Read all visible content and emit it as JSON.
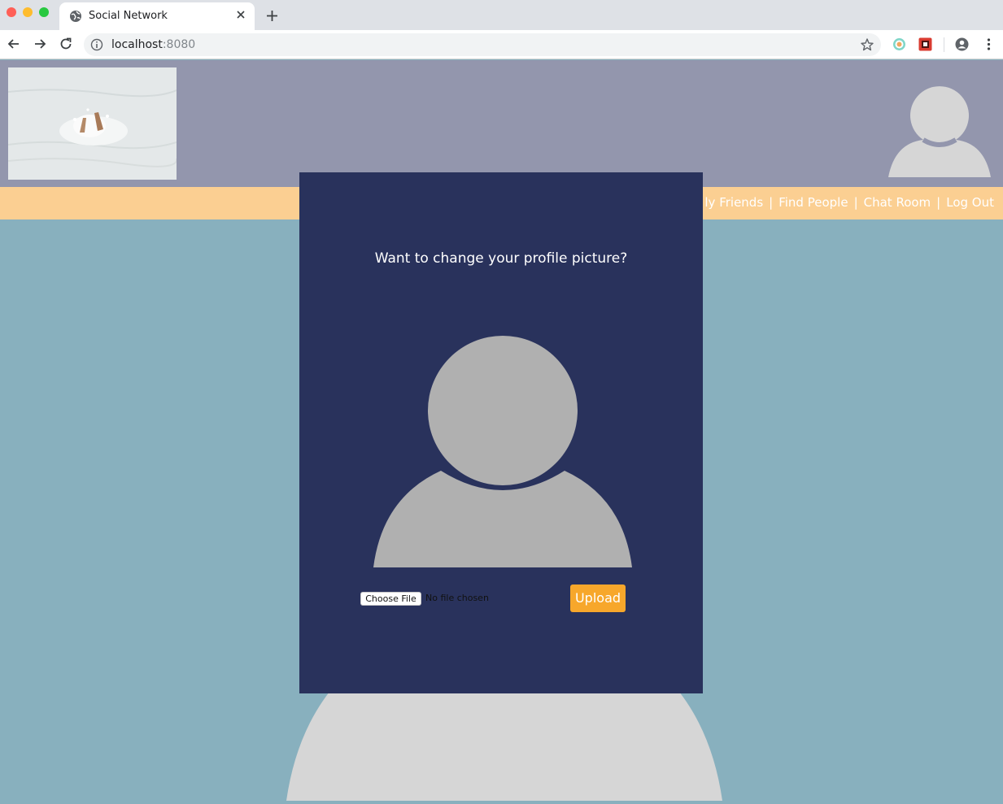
{
  "browser": {
    "tab_title": "Social Network",
    "url_host": "localhost",
    "url_port": ":8080",
    "icons": {
      "close_window": "close-window-dot",
      "minimize_window": "minimize-window-dot",
      "maximize_window": "maximize-window-dot",
      "tab_favicon": "globe-icon",
      "tab_close": "close-icon",
      "new_tab": "plus-icon",
      "back": "back-arrow-icon",
      "forward": "forward-arrow-icon",
      "reload": "reload-icon",
      "site_info": "info-icon",
      "bookmark": "star-icon",
      "profile": "account-circle-icon",
      "menu": "kebab-menu-icon"
    },
    "colors": {
      "close": "#ff5f57",
      "minimize": "#febc2e",
      "maximize": "#28c840"
    }
  },
  "header": {
    "logo_alt": "hands-in-water-logo",
    "avatar": "user-avatar-icon"
  },
  "navbar": {
    "links": [
      "ly Friends",
      "Find People",
      "Chat Room",
      "Log Out"
    ],
    "separator": "|"
  },
  "modal": {
    "title": "Want to change your profile picture?",
    "avatar": "user-silhouette-icon",
    "choose_file_label": "Choose File",
    "no_file_text": "No file chosen",
    "upload_label": "Upload"
  },
  "colors": {
    "header_bg": "#9396ad",
    "navbar_bg": "#fbcf92",
    "page_bg": "#88b0be",
    "modal_bg": "#29325c",
    "upload_bg": "#f7a72b",
    "avatar_gray": "#d6d6d6",
    "modal_avatar_gray": "#b0b0b0"
  }
}
